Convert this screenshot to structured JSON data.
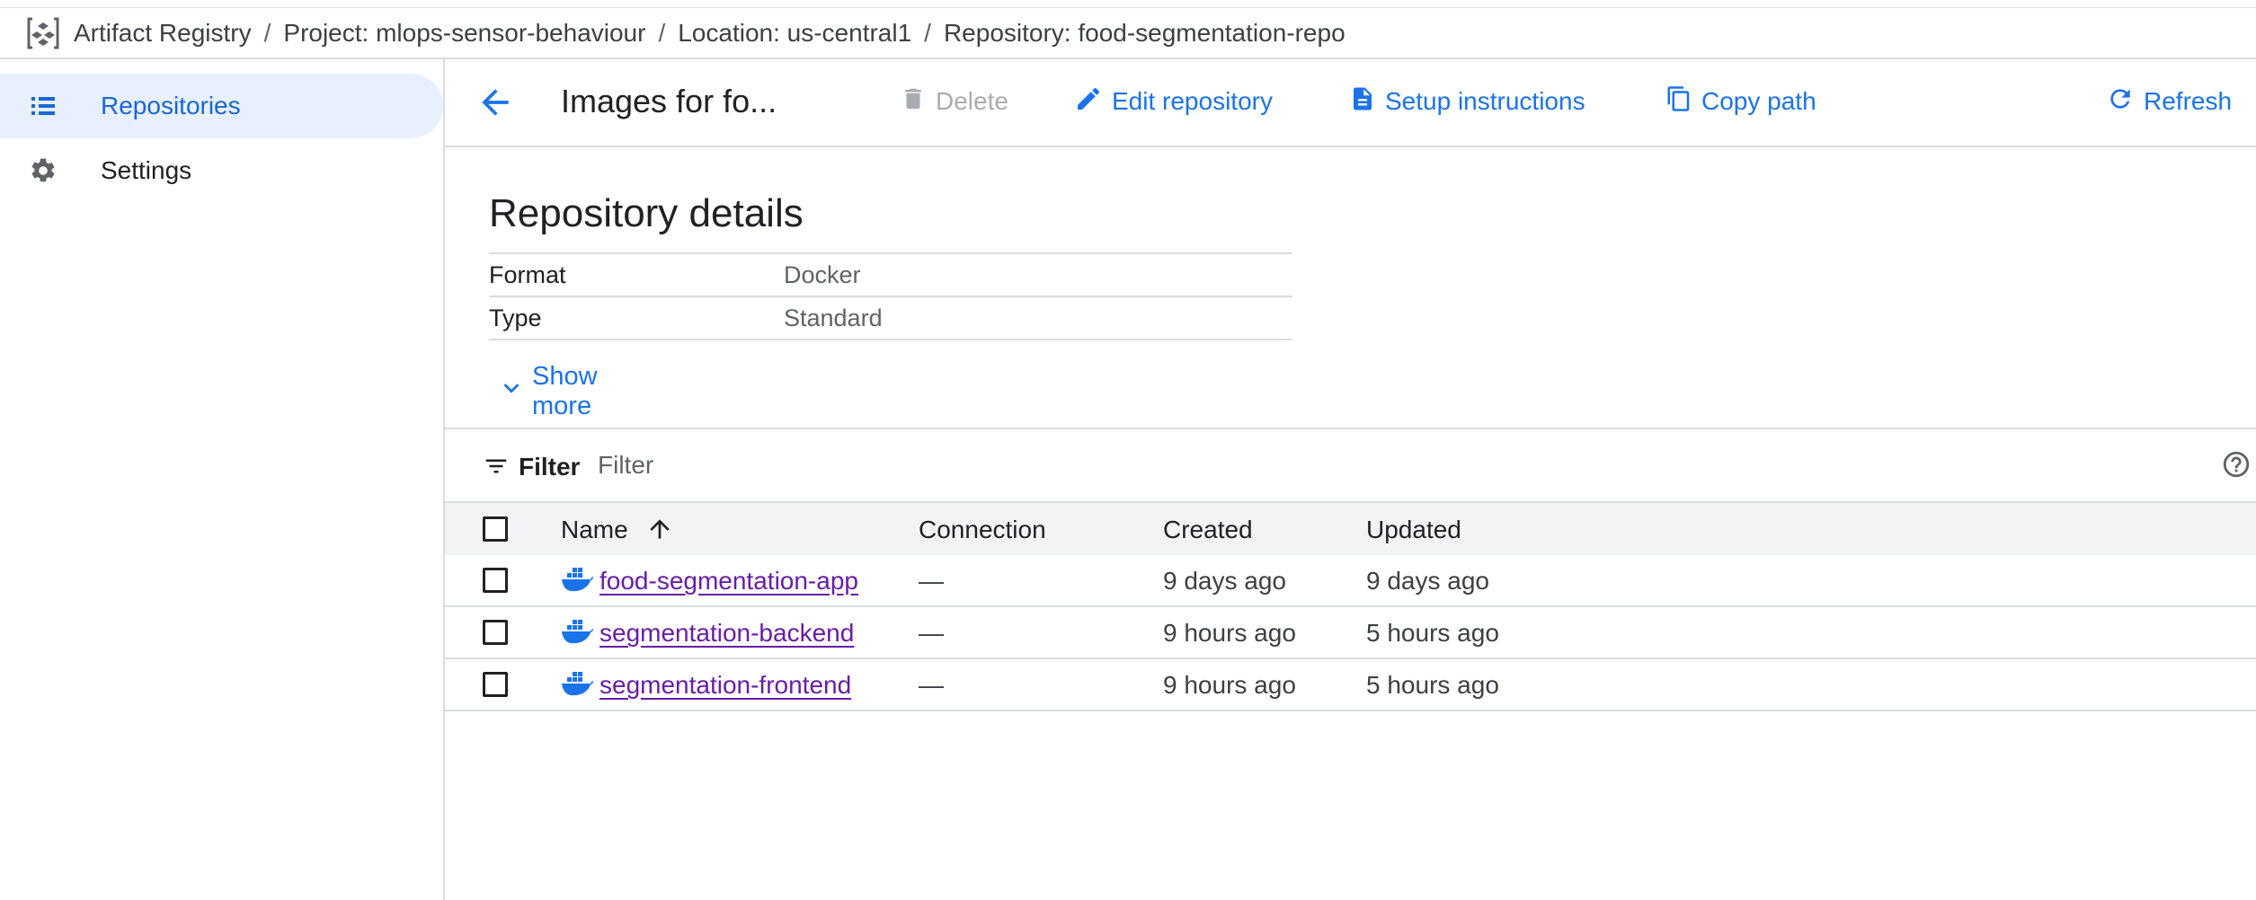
{
  "breadcrumb": {
    "app": "Artifact Registry",
    "project": "Project: mlops-sensor-behaviour",
    "location": "Location: us-central1",
    "repository": "Repository: food-segmentation-repo",
    "separator": "/"
  },
  "sidebar": {
    "items": [
      {
        "label": "Repositories",
        "icon": "list-icon",
        "active": true
      },
      {
        "label": "Settings",
        "icon": "gear-icon",
        "active": false
      }
    ]
  },
  "toolbar": {
    "title": "Images for fo...",
    "delete_label": "Delete",
    "edit_label": "Edit repository",
    "setup_label": "Setup instructions",
    "copy_label": "Copy path",
    "refresh_label": "Refresh"
  },
  "details": {
    "heading": "Repository details",
    "rows": [
      {
        "key": "Format",
        "value": "Docker"
      },
      {
        "key": "Type",
        "value": "Standard"
      }
    ],
    "show_more": "Show more"
  },
  "filter": {
    "label": "Filter",
    "placeholder": "Filter"
  },
  "table": {
    "columns": {
      "name": "Name",
      "connection": "Connection",
      "created": "Created",
      "updated": "Updated"
    },
    "rows": [
      {
        "name": "food-segmentation-app",
        "connection": "—",
        "created": "9 days ago",
        "updated": "9 days ago"
      },
      {
        "name": "segmentation-backend",
        "connection": "—",
        "created": "9 hours ago",
        "updated": "5 hours ago"
      },
      {
        "name": "segmentation-frontend",
        "connection": "—",
        "created": "9 hours ago",
        "updated": "5 hours ago"
      }
    ]
  },
  "colors": {
    "accent": "#1a73e8",
    "link_visited": "#681da8",
    "active_bg": "#e8f0fe",
    "border": "#dadce0"
  }
}
